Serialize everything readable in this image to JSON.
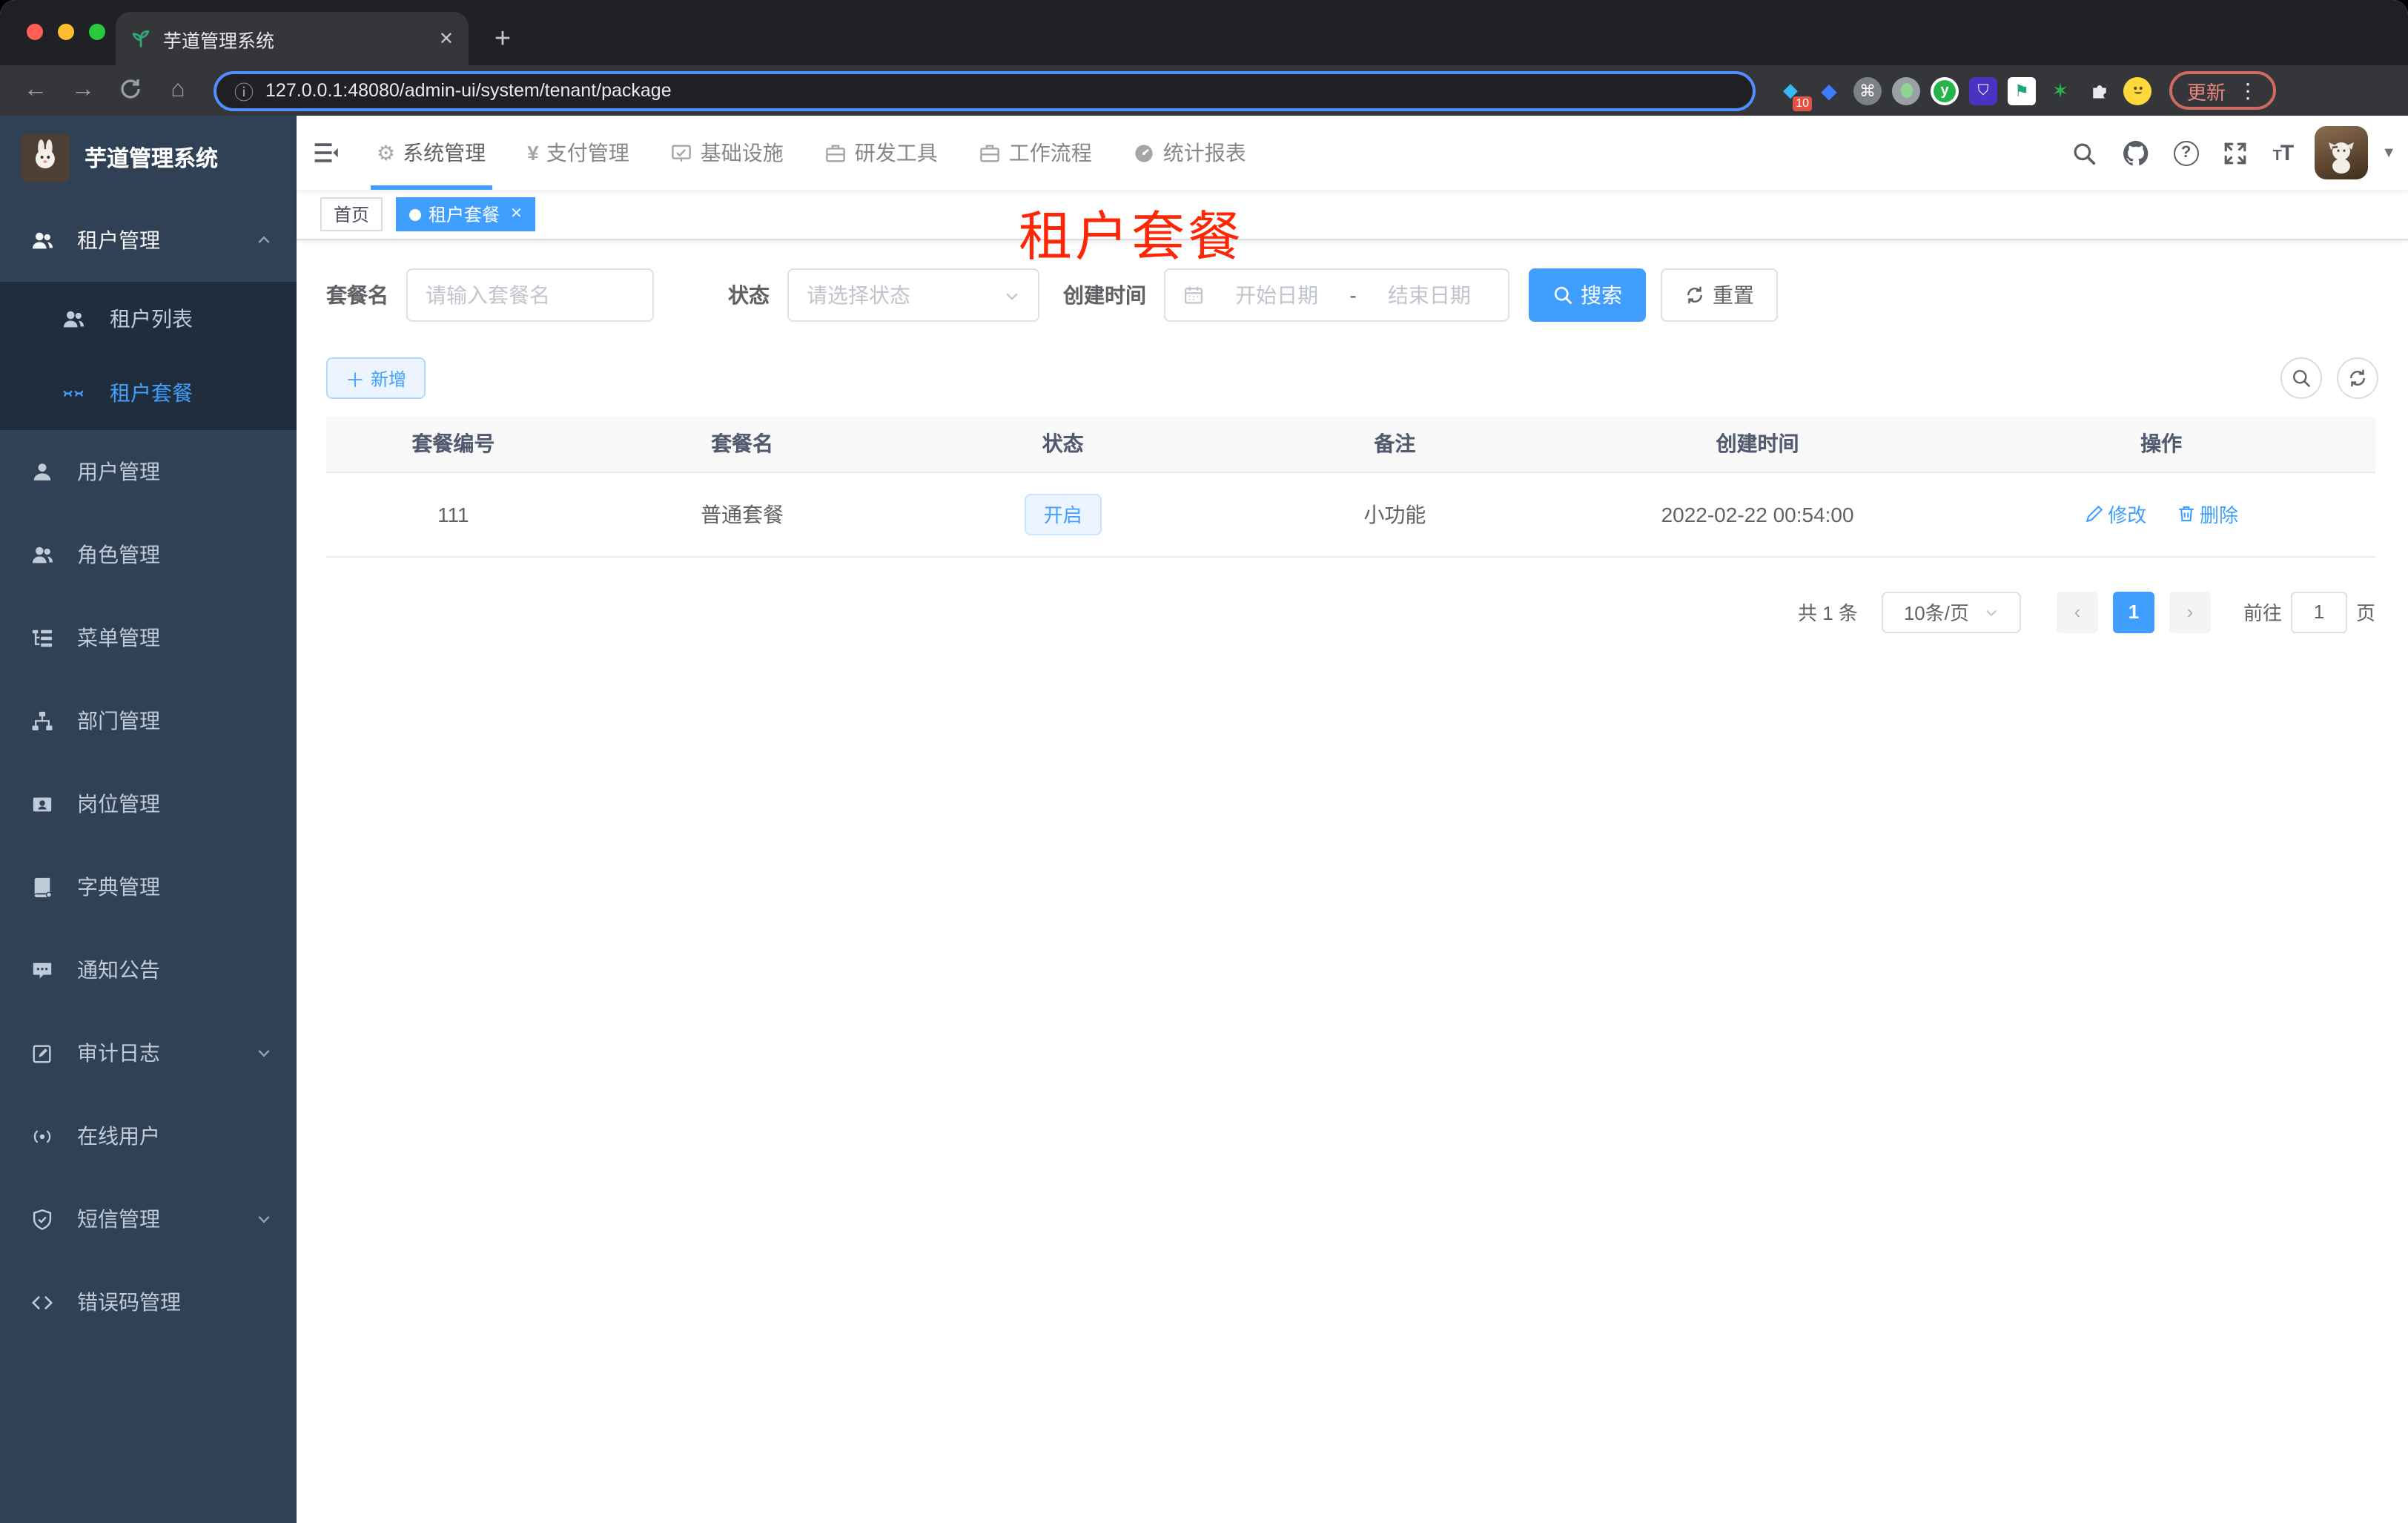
{
  "browser": {
    "tab_title": "芋道管理系统",
    "url": "127.0.0.1:48080/admin-ui/system/tenant/package",
    "extension_badge": "10",
    "update_label": "更新"
  },
  "sidebar": {
    "logo_title": "芋道管理系统",
    "items": [
      {
        "label": "租户管理"
      },
      {
        "label": "租户列表"
      },
      {
        "label": "租户套餐"
      },
      {
        "label": "用户管理"
      },
      {
        "label": "角色管理"
      },
      {
        "label": "菜单管理"
      },
      {
        "label": "部门管理"
      },
      {
        "label": "岗位管理"
      },
      {
        "label": "字典管理"
      },
      {
        "label": "通知公告"
      },
      {
        "label": "审计日志"
      },
      {
        "label": "在线用户"
      },
      {
        "label": "短信管理"
      },
      {
        "label": "错误码管理"
      }
    ]
  },
  "topnav": {
    "items": [
      {
        "label": "系统管理"
      },
      {
        "label": "支付管理"
      },
      {
        "label": "基础设施"
      },
      {
        "label": "研发工具"
      },
      {
        "label": "工作流程"
      },
      {
        "label": "统计报表"
      }
    ]
  },
  "tags": {
    "home": "首页",
    "current": "租户套餐"
  },
  "annotation": "租户套餐",
  "filters": {
    "name_label": "套餐名",
    "name_placeholder": "请输入套餐名",
    "status_label": "状态",
    "status_placeholder": "请选择状态",
    "date_label": "创建时间",
    "date_start_placeholder": "开始日期",
    "date_separator": "-",
    "date_end_placeholder": "结束日期",
    "search_label": "搜索",
    "reset_label": "重置"
  },
  "toolbar": {
    "add_label": "新增"
  },
  "table": {
    "headers": [
      "套餐编号",
      "套餐名",
      "状态",
      "备注",
      "创建时间",
      "操作"
    ],
    "rows": [
      {
        "id": "111",
        "name": "普通套餐",
        "status": "开启",
        "remark": "小功能",
        "created": "2022-02-22 00:54:00",
        "edit_label": "修改",
        "delete_label": "删除"
      }
    ]
  },
  "pagination": {
    "total": "共 1 条",
    "page_size": "10条/页",
    "current_page": "1",
    "goto_label": "前往",
    "goto_value": "1",
    "page_suffix": "页"
  },
  "colors": {
    "accent_blue": "#409eff",
    "sidebar_bg": "#304156",
    "submenu_bg": "#1f2d3d",
    "annotation_red": "#fd2708"
  }
}
